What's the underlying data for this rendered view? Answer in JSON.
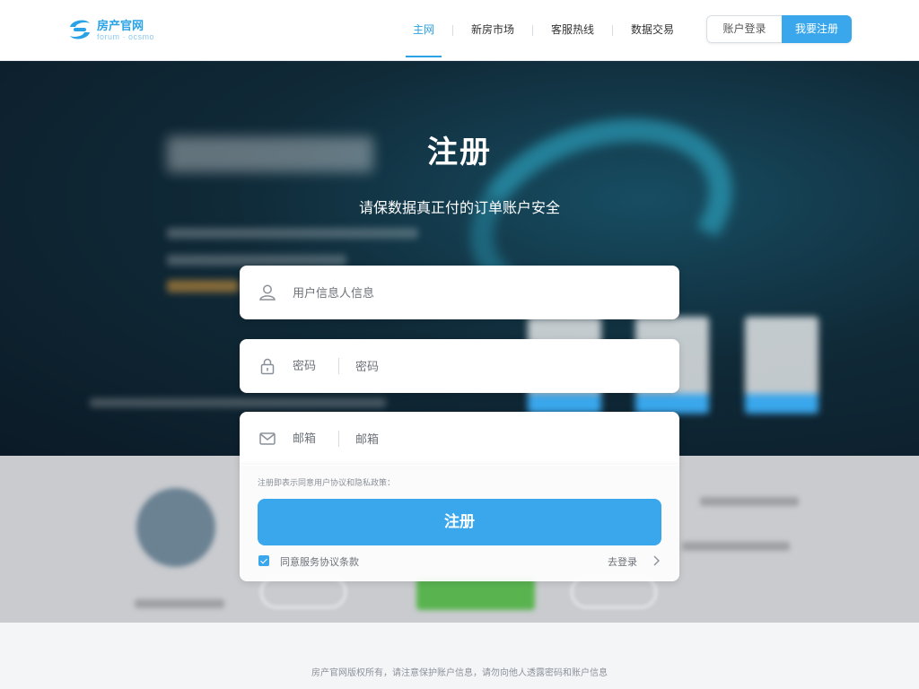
{
  "brand": {
    "name": "房产官网",
    "sub": "forum · ocsmo"
  },
  "nav": [
    {
      "label": "主网",
      "active": true
    },
    {
      "label": "新房市场",
      "active": false
    },
    {
      "label": "客服热线",
      "active": false
    },
    {
      "label": "数据交易",
      "active": false
    }
  ],
  "header": {
    "login_label": "账户登录",
    "register_label": "我要注册"
  },
  "form": {
    "title": "注册",
    "subtitle": "请保数据真正付的订单账户安全",
    "username_placeholder": "用户信息人信息",
    "password_label": "密码",
    "password_placeholder": "密码",
    "email_label": "邮箱",
    "email_placeholder": "邮箱",
    "agree_hint": "注册即表示同意用户协议和隐私政策：",
    "submit_label": "注册",
    "remember_label": "同意服务协议条款",
    "login_link": "去登录"
  },
  "footer": {
    "text": "房产官网版权所有，请注意保护账户信息，请勿向他人透露密码和账户信息"
  },
  "colors": {
    "accent": "#3aa7ec",
    "hero_dark": "#0b1a26"
  }
}
